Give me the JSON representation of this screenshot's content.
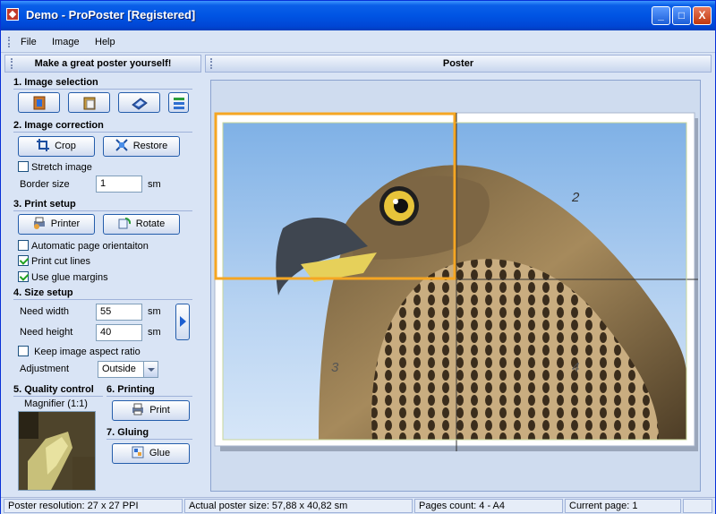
{
  "window": {
    "title": "Demo - ProPoster [Registered]",
    "min_label": "_",
    "max_label": "□",
    "close_label": "X"
  },
  "menu": {
    "items": [
      "File",
      "Image",
      "Help"
    ]
  },
  "left_panel": {
    "header": "Make a great poster yourself!",
    "s1_title": "1. Image selection",
    "s2_title": "2. Image correction",
    "crop_label": "Crop",
    "restore_label": "Restore",
    "stretch_label": "Stretch image",
    "border_label": "Border size",
    "border_value": "1",
    "border_unit": "sm",
    "s3_title": "3. Print setup",
    "printer_label": "Printer",
    "rotate_label": "Rotate",
    "auto_orient_label": "Automatic page orientaiton",
    "cut_lines_label": "Print cut lines",
    "glue_margins_label": "Use glue margins",
    "s4_title": "4. Size setup",
    "need_width_label": "Need width",
    "need_width_value": "55",
    "need_height_label": "Need height",
    "need_height_value": "40",
    "size_unit": "sm",
    "aspect_label": "Keep image aspect ratio",
    "adjust_label": "Adjustment",
    "adjust_value": "Outside",
    "s5_title": "5. Quality control",
    "magnifier_label": "Magnifier (1:1)",
    "s6_title": "6. Printing",
    "print_label": "Print",
    "s7_title": "7. Gluing",
    "glue_label": "Glue"
  },
  "checks": {
    "stretch": false,
    "auto_orient": false,
    "cut_lines": true,
    "glue_margins": true,
    "aspect": false
  },
  "right_panel": {
    "header": "Poster",
    "page_numbers": [
      "2",
      "3",
      "4"
    ]
  },
  "colors": {
    "selection": "#f5a623",
    "title_blue": "#0054e3"
  },
  "status": {
    "resolution": "Poster resolution: 27 x 27 PPI",
    "actual_size": "Actual poster size: 57,88 x 40,82 sm",
    "pages_count": "Pages count: 4 - A4",
    "current_page": "Current page: 1"
  }
}
